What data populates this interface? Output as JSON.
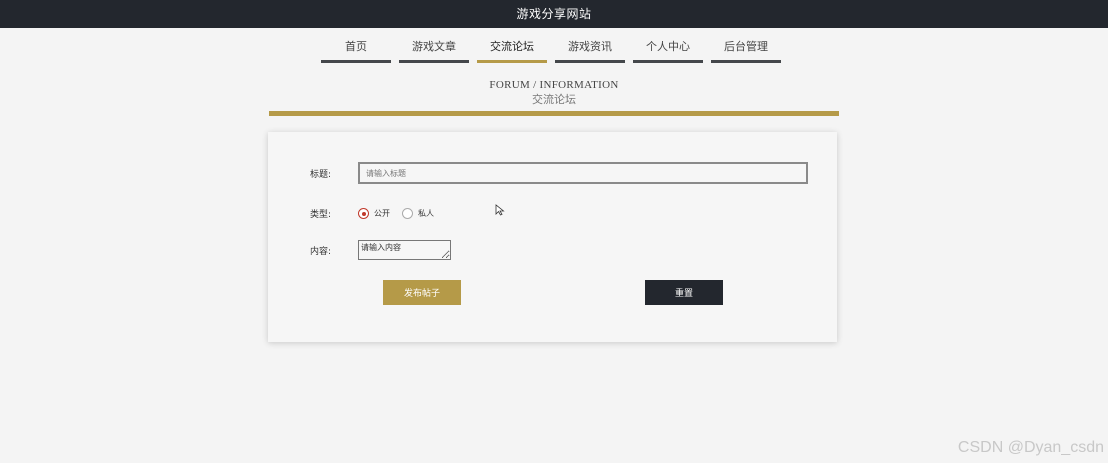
{
  "header": {
    "site_title": "游戏分享网站"
  },
  "nav": {
    "items": [
      {
        "label": "首页"
      },
      {
        "label": "游戏文章"
      },
      {
        "label": "交流论坛"
      },
      {
        "label": "游戏资讯"
      },
      {
        "label": "个人中心"
      },
      {
        "label": "后台管理"
      }
    ],
    "active_index": 2
  },
  "section": {
    "title_en": "FORUM / INFORMATION",
    "title_cn": "交流论坛"
  },
  "form": {
    "title_label": "标题:",
    "title_placeholder": "请输入标题",
    "type_label": "类型:",
    "type_options": [
      "公开",
      "私人"
    ],
    "type_selected": "公开",
    "content_label": "内容:",
    "content_placeholder": "请输入内容",
    "submit_label": "发布帖子",
    "reset_label": "重置"
  },
  "colors": {
    "accent": "#b59a48",
    "dark": "#23272e",
    "radio_checked": "#c0392b"
  },
  "watermark": "CSDN @Dyan_csdn"
}
